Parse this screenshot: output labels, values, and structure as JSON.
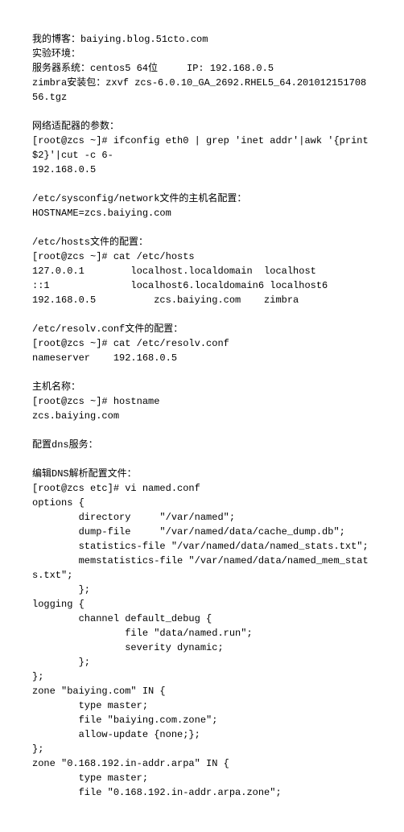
{
  "l1": "我的博客：baiying.blog.51cto.com",
  "l2": "实验环境：",
  "l3": "服务器系统：centos5 64位     IP: 192.168.0.5",
  "l4": "zimbra安装包：zxvf zcs-6.0.10_GA_2692.RHEL5_64.20101215170856.tgz",
  "sp1": " ",
  "l5": "网络适配器的参数：",
  "l6": "[root@zcs ~]# ifconfig eth0 | grep 'inet addr'|awk '{print $2}'|cut -c 6-",
  "l7": "192.168.0.5",
  "sp2": " ",
  "l8": "/etc/sysconfig/network文件的主机名配置：",
  "l9": "HOSTNAME=zcs.baiying.com",
  "sp3": " ",
  "l10": "/etc/hosts文件的配置：",
  "l11": "[root@zcs ~]# cat /etc/hosts",
  "l12": "127.0.0.1        localhost.localdomain  localhost",
  "l13": "::1              localhost6.localdomain6 localhost6",
  "l14": "192.168.0.5          zcs.baiying.com    zimbra",
  "sp4": " ",
  "l15": "/etc/resolv.conf文件的配置：",
  "l16": "[root@zcs ~]# cat /etc/resolv.conf",
  "l17": "nameserver    192.168.0.5",
  "sp5": " ",
  "l18": "主机名称：",
  "l19": "[root@zcs ~]# hostname",
  "l20": "zcs.baiying.com",
  "sp6": " ",
  "l21": "配置dns服务：",
  "sp7": " ",
  "l22": "编辑DNS解析配置文件：",
  "l23": "[root@zcs etc]# vi named.conf",
  "l24": "options {",
  "l25": "        directory     \"/var/named\";",
  "l26": "        dump-file     \"/var/named/data/cache_dump.db\";",
  "l27": "        statistics-file \"/var/named/data/named_stats.txt\";",
  "l28": "        memstatistics-file \"/var/named/data/named_mem_stats.txt\";",
  "l29": "        };",
  "l30": "logging {",
  "l31": "        channel default_debug {",
  "l32": "                file \"data/named.run\";",
  "l33": "                severity dynamic;",
  "l34": "        };",
  "l35": "};",
  "l36": "zone \"baiying.com\" IN {",
  "l37": "        type master;",
  "l38": "        file \"baiying.com.zone\";",
  "l39": "        allow-update {none;};",
  "l40": "};",
  "l41": "zone \"0.168.192.in-addr.arpa\" IN {",
  "l42": "        type master;",
  "l43": "        file \"0.168.192.in-addr.arpa.zone\";"
}
